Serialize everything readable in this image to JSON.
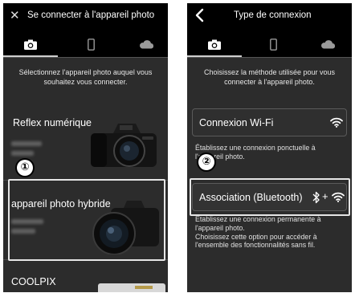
{
  "left_screen": {
    "header": {
      "title": "Se connecter à l'appareil photo",
      "close_icon": "close-icon"
    },
    "tabs": [
      {
        "icon": "camera-icon",
        "selected": true
      },
      {
        "icon": "smartphone-icon",
        "selected": false
      },
      {
        "icon": "cloud-icon",
        "selected": false
      }
    ],
    "intro": "Sélectionnez l'appareil photo auquel vous souhaitez vous connecter.",
    "cameras": [
      {
        "label": "Reflex numérique"
      },
      {
        "label": "appareil photo hybride",
        "selected": true
      },
      {
        "label": "COOLPIX"
      }
    ],
    "callout": "①"
  },
  "right_screen": {
    "header": {
      "title": "Type de connexion",
      "back_icon": "back-chevron-icon"
    },
    "tabs": [
      {
        "icon": "camera-icon",
        "selected": true
      },
      {
        "icon": "smartphone-icon",
        "selected": false
      },
      {
        "icon": "cloud-icon",
        "selected": false
      }
    ],
    "intro": "Choisissez la méthode utilisée pour vous connecter à l'appareil photo.",
    "options": [
      {
        "label": "Connexion Wi-Fi",
        "icons": [
          "wifi-icon"
        ],
        "description": "Établissez une connexion ponctuelle à l'appareil photo."
      },
      {
        "label": "Association (Bluetooth)",
        "icons": [
          "bluetooth-icon",
          "wifi-icon"
        ],
        "plus": "+",
        "selected": true,
        "description": "Établissez une connexion permanente à l'appareil photo.",
        "description_2": "Choisissez cette option pour accéder à l'ensemble des fonctionnalités sans fil."
      }
    ],
    "callout": "②"
  },
  "colors": {
    "background": "#2c2c2c",
    "header": "#000000",
    "text": "#ffffff",
    "selection": "#e6e6e6"
  }
}
